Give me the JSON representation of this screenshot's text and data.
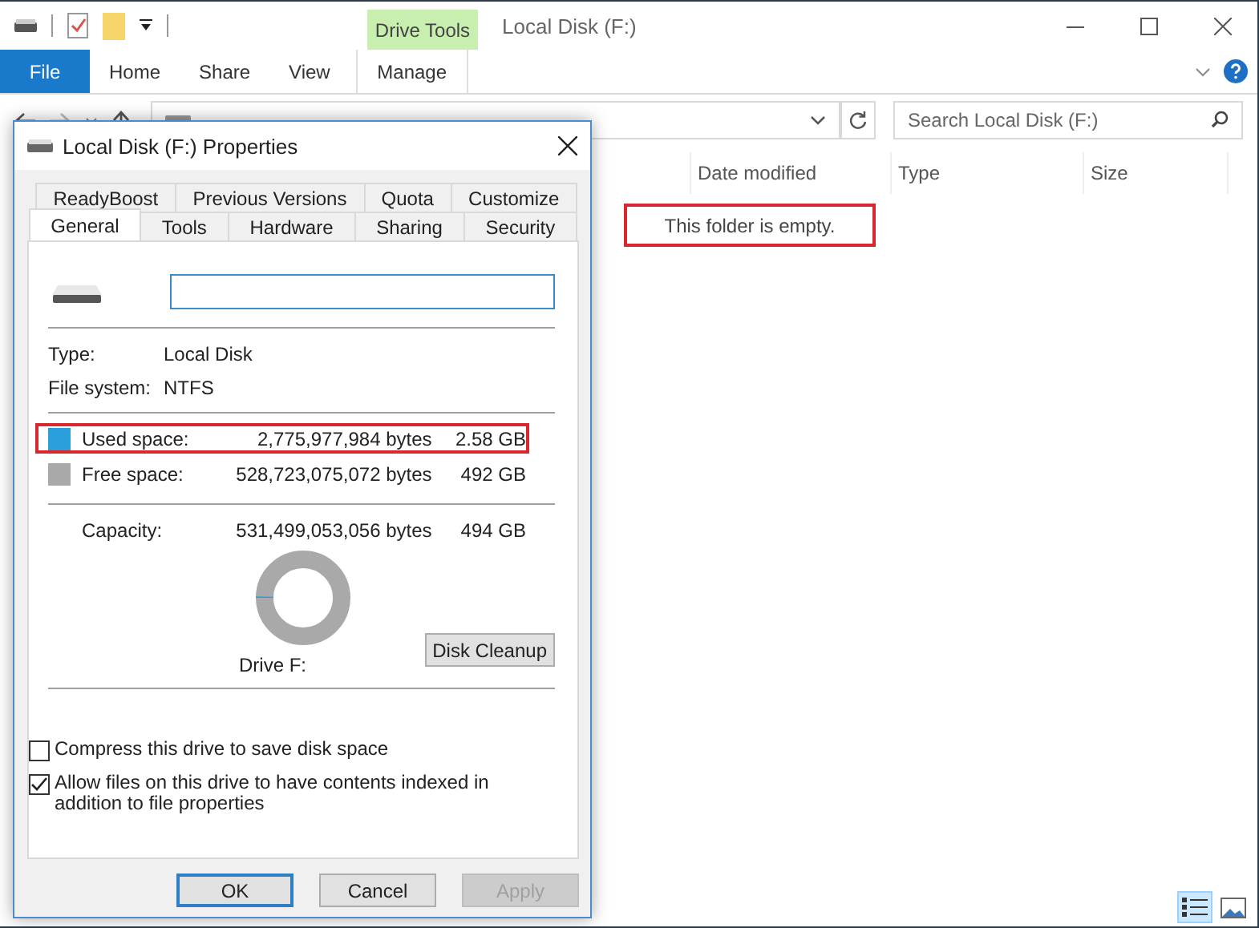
{
  "explorer": {
    "title": "Local Disk (F:)",
    "context_tab": "Drive Tools",
    "ribbon_tabs": [
      {
        "label": "File",
        "kind": "file"
      },
      {
        "label": "Home",
        "kind": "tab"
      },
      {
        "label": "Share",
        "kind": "tab"
      },
      {
        "label": "View",
        "kind": "tab"
      },
      {
        "label": "Manage",
        "kind": "context"
      }
    ],
    "search": {
      "placeholder": "Search Local Disk (F:)"
    },
    "columns": [
      "Date modified",
      "Type",
      "Size"
    ],
    "empty_message": {
      "text": "This folder is empty.",
      "highlighted": true
    },
    "views": [
      {
        "kind": "details",
        "selected": true
      },
      {
        "kind": "large_icons",
        "selected": false
      }
    ]
  },
  "dialog": {
    "title": "Local Disk (F:) Properties",
    "tab_rows": [
      [
        {
          "label": "ReadyBoost",
          "selected": false
        },
        {
          "label": "Previous Versions",
          "selected": false
        },
        {
          "label": "Quota",
          "selected": false
        },
        {
          "label": "Customize",
          "selected": false
        }
      ],
      [
        {
          "label": "General",
          "selected": true
        },
        {
          "label": "Tools",
          "selected": false
        },
        {
          "label": "Hardware",
          "selected": false
        },
        {
          "label": "Sharing",
          "selected": false
        },
        {
          "label": "Security",
          "selected": false
        }
      ]
    ],
    "info": [
      {
        "label": "Type:",
        "value": "Local Disk"
      },
      {
        "label": "File system:",
        "value": "NTFS"
      }
    ],
    "space": [
      {
        "label": "Used space:",
        "bytes": "2,775,977,984 bytes",
        "size": "2.58 GB",
        "color": "#2b9fdc",
        "highlighted": true
      },
      {
        "label": "Free space:",
        "bytes": "528,723,075,072 bytes",
        "size": "492 GB",
        "color": "#a9a9a9",
        "highlighted": false
      }
    ],
    "capacity": {
      "label": "Capacity:",
      "bytes": "531,499,053,056 bytes",
      "size": "494 GB"
    },
    "usage": {
      "level": 0.005,
      "label": "Drive F:"
    },
    "cleanup_button": "Disk Cleanup",
    "options": [
      {
        "label": "Compress this drive to save disk space",
        "checked": false
      },
      {
        "label": "Allow files on this drive to have contents indexed in addition to file properties",
        "checked": true
      }
    ],
    "buttons": [
      {
        "label": "OK",
        "kind": "default",
        "disabled": false
      },
      {
        "label": "Cancel",
        "kind": "normal",
        "disabled": false
      },
      {
        "label": "Apply",
        "kind": "normal",
        "disabled": true
      }
    ]
  }
}
